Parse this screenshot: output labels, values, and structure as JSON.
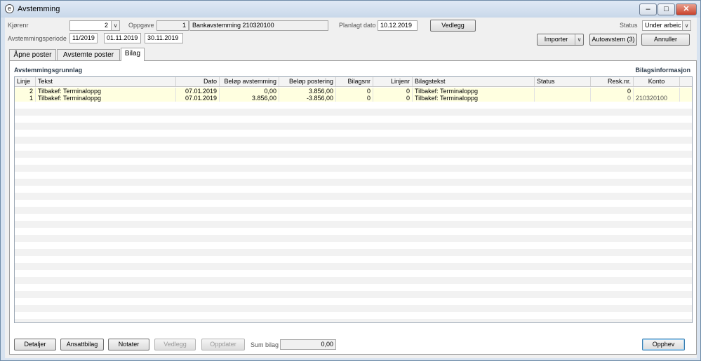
{
  "window": {
    "title": "Avstemming",
    "app_icon": "e"
  },
  "header": {
    "kjorenr_label": "Kjørenr",
    "kjorenr_value": "2",
    "oppgave_label": "Oppgave",
    "oppgave_no": "1",
    "oppgave_text": "Bankavstemming 210320100",
    "planlagt_label": "Planlagt dato",
    "planlagt_value": "10.12.2019",
    "vedlegg_button": "Vedlegg",
    "status_label": "Status",
    "status_value": "Under arbeic",
    "periode_label": "Avstemmingsperiode",
    "periode_value": "11/2019",
    "periode_from": "01.11.2019",
    "periode_to": "30.11.2019",
    "importer_button": "Importer",
    "autoavstem_button": "Autoavstem (3)",
    "annuller_button": "Annuller"
  },
  "tabs": [
    {
      "label": "Åpne poster"
    },
    {
      "label": "Avstemte poster"
    },
    {
      "label": "Bilag"
    }
  ],
  "panel": {
    "left_title": "Avstemmingsgrunnlag",
    "right_title": "Bilagsinformasjon"
  },
  "table": {
    "columns": [
      "Linje",
      "Tekst",
      "Dato",
      "Beløp avstemming",
      "Beløp postering",
      "Bilagsnr",
      "Linjenr",
      "Bilagstekst",
      "Status",
      "Resk.nr.",
      "Konto"
    ],
    "rows": [
      [
        "2",
        "Tilbakef: Terminaloppg",
        "07.01.2019",
        "0,00",
        "3.856,00",
        "0",
        "0",
        "Tilbakef: Terminaloppg",
        "",
        "0",
        ""
      ],
      [
        "1",
        "Tilbakef: Terminaloppg",
        "07.01.2019",
        "3.856,00",
        "-3.856,00",
        "0",
        "0",
        "Tilbakef: Terminaloppg",
        "",
        "0",
        "210320100"
      ]
    ]
  },
  "footer": {
    "detaljer": "Detaljer",
    "ansattbilag": "Ansattbilag",
    "notater": "Notater",
    "vedlegg": "Vedlegg",
    "oppdater": "Oppdater",
    "sum_label": "Sum bilag",
    "sum_value": "0,00",
    "opphev": "Opphev"
  },
  "colors": {
    "title_bg": "#c9d8ea",
    "row_highlight": "#ffffe0",
    "stripe": "#f2f2f2"
  }
}
